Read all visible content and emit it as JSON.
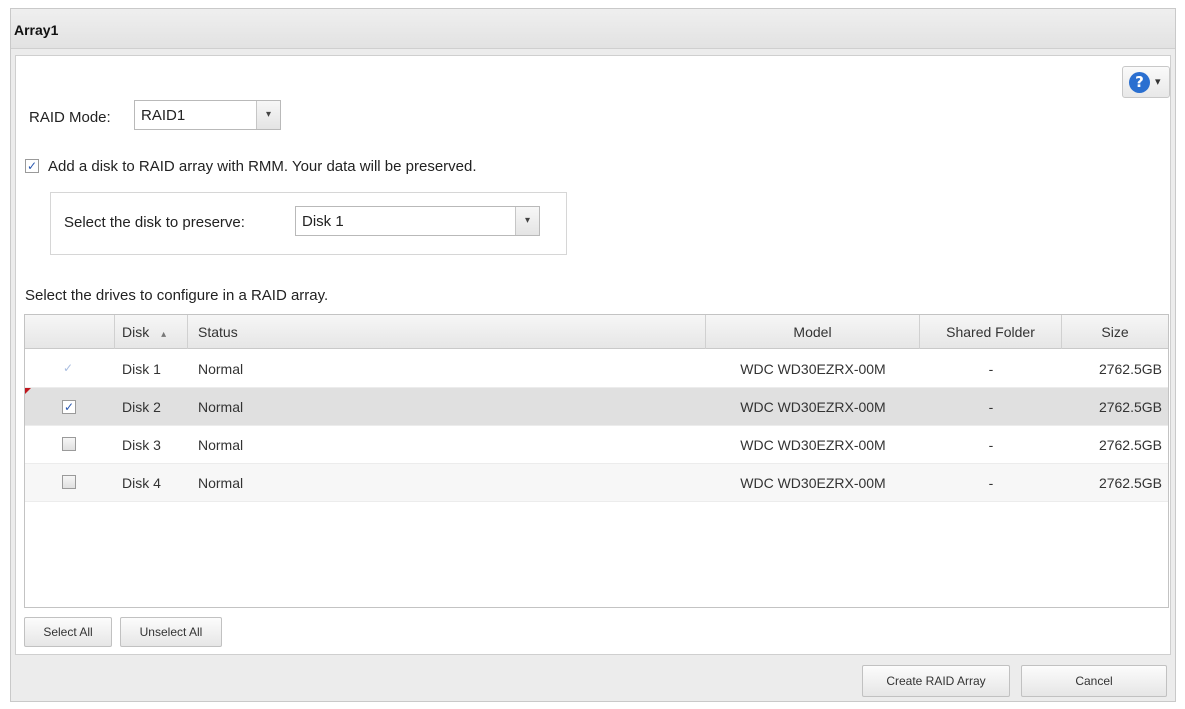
{
  "window": {
    "title": "Array1"
  },
  "help": {
    "glyph": "?",
    "caret": "▾"
  },
  "raid_mode": {
    "label": "RAID Mode:",
    "value": "RAID1",
    "arrow": "▾"
  },
  "rmm": {
    "checked": true,
    "label": "Add a disk to RAID array with RMM. Your data will be preserved."
  },
  "preserve": {
    "label": "Select the disk to preserve:",
    "value": "Disk 1",
    "arrow": "▾"
  },
  "drives": {
    "instruction": "Select the drives to configure in a RAID array.",
    "columns": {
      "disk": "Disk",
      "sort_indicator": "▴",
      "status": "Status",
      "model": "Model",
      "shared_folder": "Shared Folder",
      "size": "Size"
    },
    "rows": [
      {
        "check": "✓",
        "checked": true,
        "disk": "Disk 1",
        "status": "Normal",
        "model": "WDC WD30EZRX-00M",
        "shared_folder": "-",
        "size": "2762.5GB"
      },
      {
        "check": "✓",
        "checked": true,
        "disk": "Disk 2",
        "status": "Normal",
        "model": "WDC WD30EZRX-00M",
        "shared_folder": "-",
        "size": "2762.5GB"
      },
      {
        "check": "",
        "checked": false,
        "disk": "Disk 3",
        "status": "Normal",
        "model": "WDC WD30EZRX-00M",
        "shared_folder": "-",
        "size": "2762.5GB"
      },
      {
        "check": "",
        "checked": false,
        "disk": "Disk 4",
        "status": "Normal",
        "model": "WDC WD30EZRX-00M",
        "shared_folder": "-",
        "size": "2762.5GB"
      }
    ]
  },
  "buttons": {
    "select_all": "Select All",
    "unselect_all": "Unselect All",
    "create_raid_array": "Create RAID Array",
    "cancel": "Cancel"
  },
  "check_glyph": "✓",
  "colors": {
    "help_blue": "#2a6fd0",
    "check_blue": "#2a58b0",
    "selected_row": "#e0e0e0",
    "dirty_marker": "#c0161d"
  }
}
